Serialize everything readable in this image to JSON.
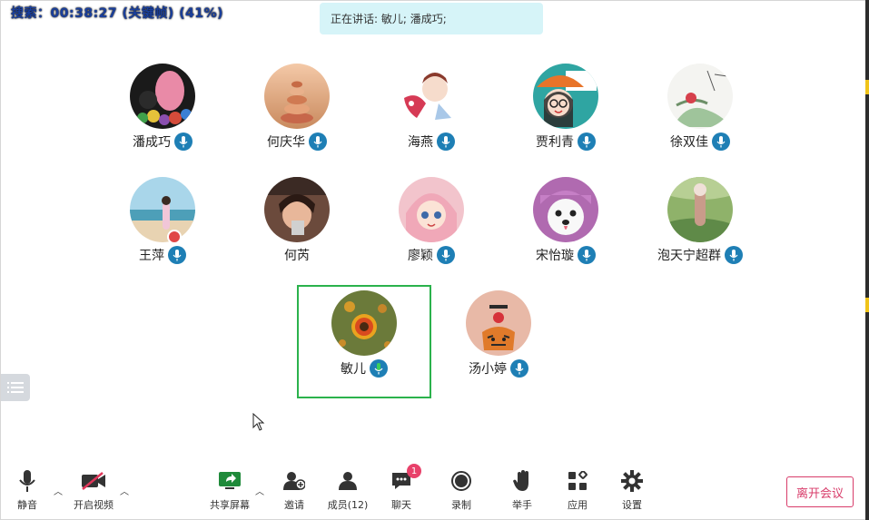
{
  "status": {
    "search_text": "搜索：00:38:27 (关键帧) (41%)"
  },
  "speaking": {
    "text": "正在讲话: 敏儿; 潘成巧;"
  },
  "participants": [
    {
      "name": "潘成巧",
      "mic": true
    },
    {
      "name": "何庆华",
      "mic": true
    },
    {
      "name": "海燕",
      "mic": true
    },
    {
      "name": "贾利青",
      "mic": true
    },
    {
      "name": "徐双佳",
      "mic": true
    },
    {
      "name": "王萍",
      "mic": true
    },
    {
      "name": "何芮",
      "mic": false
    },
    {
      "name": "廖颖",
      "mic": true
    },
    {
      "name": "宋怡璇",
      "mic": true
    },
    {
      "name": "泡天宁超群",
      "mic": true
    },
    {
      "name": "敏儿",
      "mic": true,
      "active_speaker": true
    },
    {
      "name": "汤小婷",
      "mic": true
    }
  ],
  "toolbar": {
    "mute": "静音",
    "video": "开启视频",
    "share": "共享屏幕",
    "invite": "邀请",
    "members": "成员(12)",
    "chat": "聊天",
    "chat_badge": "1",
    "record": "录制",
    "raise_hand": "举手",
    "apps": "应用",
    "settings": "设置",
    "leave": "离开会议"
  },
  "colors": {
    "accent": "#1e7fb5",
    "active_border": "#2bb24c",
    "leave": "#d83c6a",
    "speaking_bg": "#d6f4f8"
  }
}
